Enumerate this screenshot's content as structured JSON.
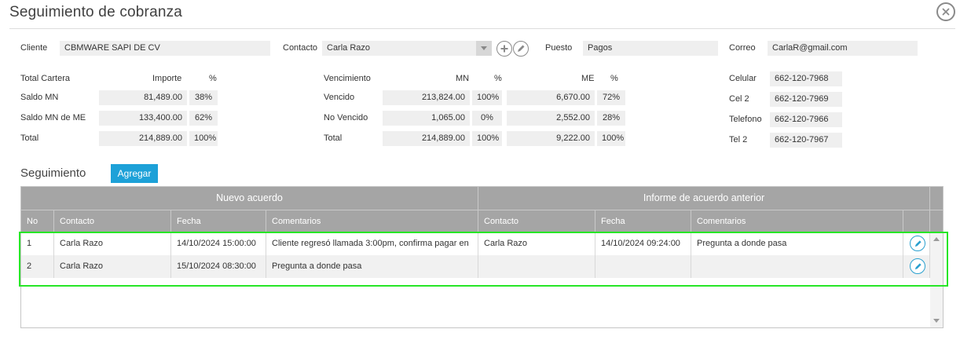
{
  "header": {
    "title": "Seguimiento de cobranza"
  },
  "top": {
    "cliente_label": "Cliente",
    "cliente_value": "CBMWARE SAPI DE CV",
    "contacto_label": "Contacto",
    "contacto_value": "Carla Razo",
    "puesto_label": "Puesto",
    "puesto_value": "Pagos",
    "correo_label": "Correo",
    "correo_value": "CarlaR@gmail.com"
  },
  "cartera": {
    "title": "Total Cartera",
    "col_importe": "Importe",
    "col_pct": "%",
    "rows": [
      {
        "label": "Saldo MN",
        "importe": "81,489.00",
        "pct": "38%"
      },
      {
        "label": "Saldo MN de ME",
        "importe": "133,400.00",
        "pct": "62%"
      },
      {
        "label": "Total",
        "importe": "214,889.00",
        "pct": "100%"
      }
    ]
  },
  "vencimiento": {
    "title": "Vencimiento",
    "col_mn": "MN",
    "col_pct1": "%",
    "col_me": "ME",
    "col_pct2": "%",
    "rows": [
      {
        "label": "Vencido",
        "mn": "213,824.00",
        "pct_mn": "100%",
        "me": "6,670.00",
        "pct_me": "72%"
      },
      {
        "label": "No Vencido",
        "mn": "1,065.00",
        "pct_mn": "0%",
        "me": "2,552.00",
        "pct_me": "28%"
      },
      {
        "label": "Total",
        "mn": "214,889.00",
        "pct_mn": "100%",
        "me": "9,222.00",
        "pct_me": "100%"
      }
    ]
  },
  "telefonos": [
    {
      "label": "Celular",
      "value": "662-120-7968"
    },
    {
      "label": "Cel 2",
      "value": "662-120-7969"
    },
    {
      "label": "Telefono",
      "value": "662-120-7966"
    },
    {
      "label": "Tel 2",
      "value": "662-120-7967"
    }
  ],
  "seguimiento": {
    "title": "Seguimiento",
    "add_button": "Agregar",
    "group_nuevo": "Nuevo acuerdo",
    "group_anterior": "Informe de acuerdo anterior",
    "columns": [
      "No",
      "Contacto",
      "Fecha",
      "Comentarios",
      "Contacto",
      "Fecha",
      "Comentarios"
    ],
    "rows": [
      {
        "no": "1",
        "contacto": "Carla Razo",
        "fecha": "14/10/2024 15:00:00",
        "comentarios": "Cliente regresó llamada 3:00pm, confirma pagar en",
        "ant_contacto": "Carla Razo",
        "ant_fecha": "14/10/2024 09:24:00",
        "ant_comentarios": "Pregunta a donde pasa"
      },
      {
        "no": "2",
        "contacto": "Carla Razo",
        "fecha": "15/10/2024 08:30:00",
        "comentarios": "Pregunta a donde pasa",
        "ant_contacto": "",
        "ant_fecha": "",
        "ant_comentarios": ""
      }
    ]
  },
  "icons": {
    "close": "close-icon",
    "add": "plus-circle-icon",
    "edit": "pencil-icon"
  },
  "colors": {
    "accent": "#1da1d8",
    "header_gray": "#a5a5a5",
    "highlight": "#27e627"
  }
}
